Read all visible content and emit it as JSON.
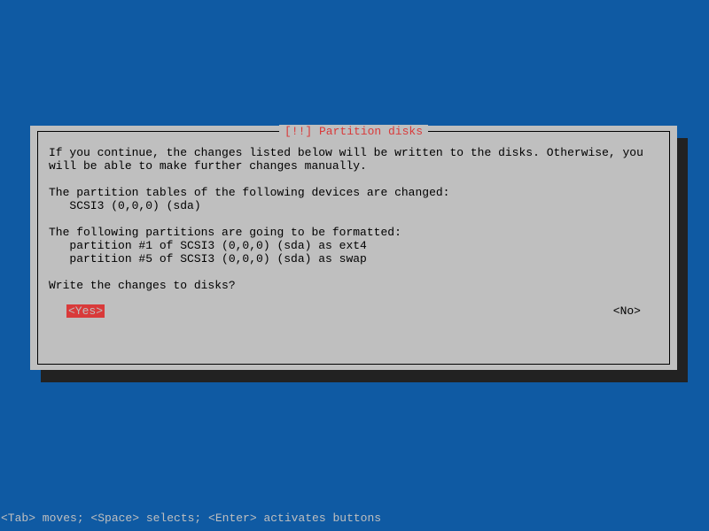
{
  "dialog": {
    "title": "[!!] Partition disks",
    "intro": "If you continue, the changes listed below will be written to the disks. Otherwise, you\nwill be able to make further changes manually.",
    "tables_heading": "The partition tables of the following devices are changed:",
    "tables_list": "   SCSI3 (0,0,0) (sda)",
    "format_heading": "The following partitions are going to be formatted:",
    "format_list": "   partition #1 of SCSI3 (0,0,0) (sda) as ext4\n   partition #5 of SCSI3 (0,0,0) (sda) as swap",
    "question": "Write the changes to disks?",
    "yes_label": "<Yes>",
    "no_label": "<No>"
  },
  "footer": {
    "help": "<Tab> moves; <Space> selects; <Enter> activates buttons"
  }
}
